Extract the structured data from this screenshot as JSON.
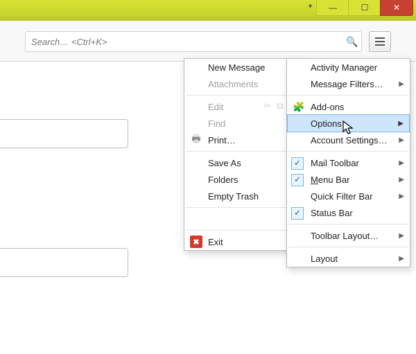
{
  "window": {
    "dropdown_glyph": "▾",
    "min": "—",
    "max": "☐",
    "close": "✕"
  },
  "search": {
    "placeholder": "Search… <Ctrl+K>"
  },
  "menu1": {
    "new_message": "New Message",
    "attachments": "Attachments",
    "edit": "Edit",
    "find": "Find",
    "print": "Print…",
    "save_as": "Save As",
    "folders": "Folders",
    "empty_trash": "Empty Trash",
    "exit": "Exit"
  },
  "menu2": {
    "activity_manager": "Activity Manager",
    "message_filters": "Message Filters…",
    "addons": "Add-ons",
    "options": "Options…",
    "account_settings": "Account Settings…",
    "mail_toolbar": "Mail Toolbar",
    "menu_bar_prefix": "M",
    "menu_bar_rest": "enu Bar",
    "quick_filter_bar": "Quick Filter Bar",
    "status_bar": "Status Bar",
    "toolbar_layout": "Toolbar Layout…",
    "layout": "Layout"
  }
}
